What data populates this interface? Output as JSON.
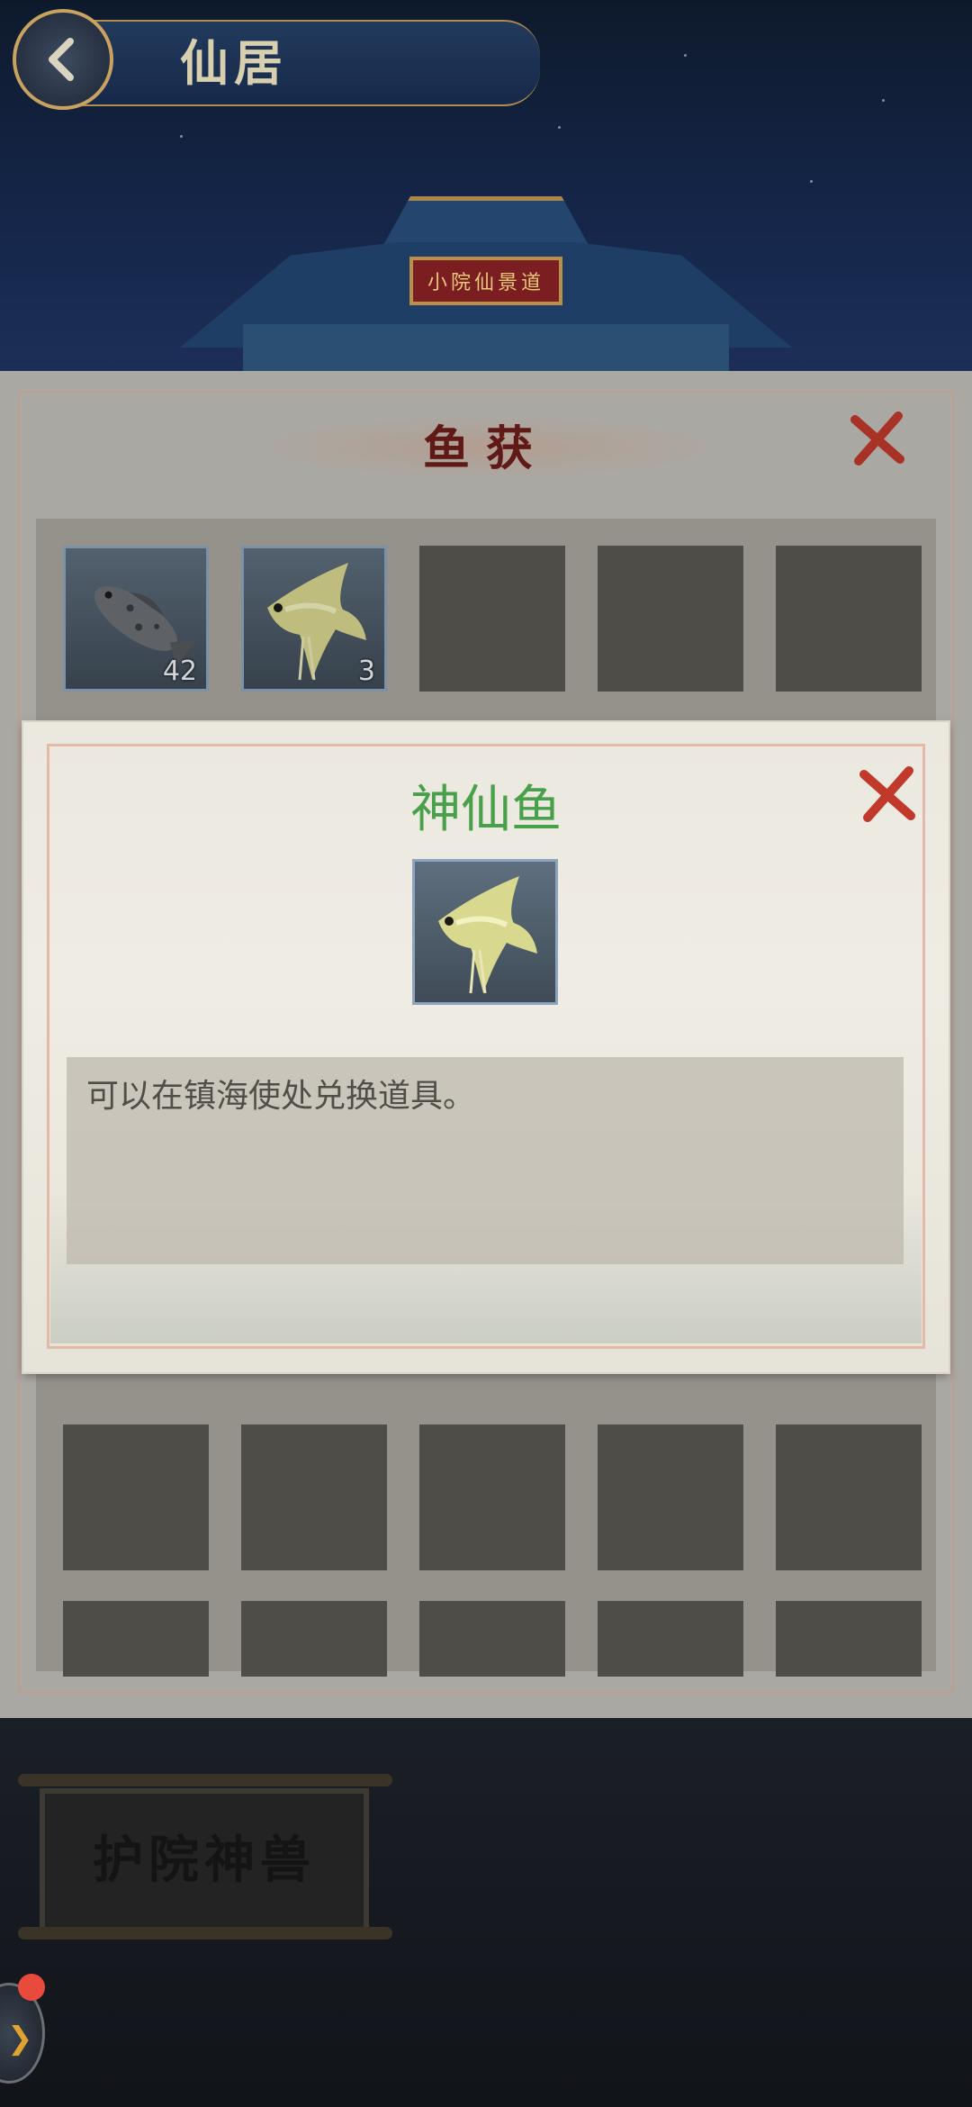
{
  "header": {
    "title": "仙居",
    "plaque_text": "小院仙景道"
  },
  "catch_panel": {
    "title": "鱼获",
    "items": [
      {
        "name": "fish-grouper",
        "count": "42"
      },
      {
        "name": "fish-angelfish",
        "count": "3"
      }
    ]
  },
  "popup": {
    "title": "神仙鱼",
    "description": "可以在镇海使处兑换道具。",
    "title_color": "#48a04a"
  },
  "bottom": {
    "scroll_label": "护院神兽"
  },
  "colors": {
    "accent_red": "#c0392b",
    "notify_dot": "#e84a3c"
  }
}
